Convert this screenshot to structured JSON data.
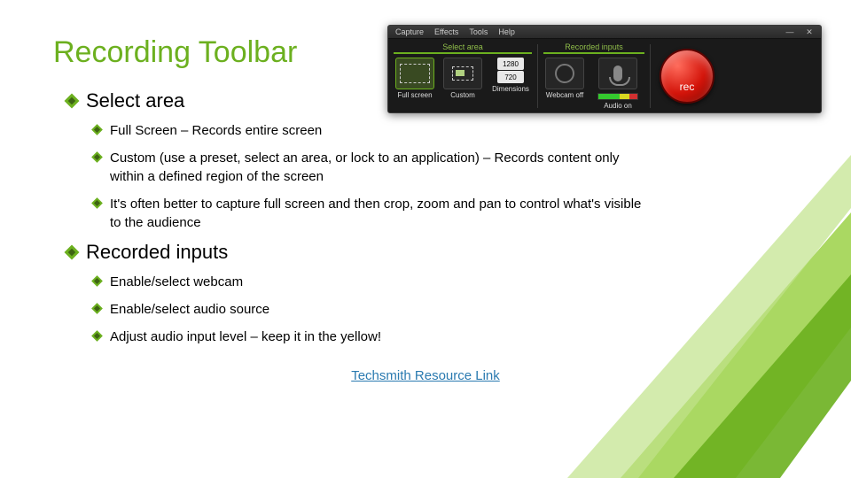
{
  "title": "Recording Toolbar",
  "sections": [
    {
      "heading": "Select area",
      "items": [
        "Full Screen – Records entire screen",
        "Custom (use a preset, select an area, or lock to an application) – Records content only within a defined region of the screen",
        "It's often better to capture full screen and then crop, zoom and pan to control what's visible to the audience"
      ]
    },
    {
      "heading": "Recorded inputs",
      "items": [
        "Enable/select webcam",
        "Enable/select audio source",
        "Adjust audio input level – keep it in the yellow!"
      ]
    }
  ],
  "link_text": "Techsmith Resource Link",
  "toolbar": {
    "menus": [
      "Capture",
      "Effects",
      "Tools",
      "Help"
    ],
    "group1_title": "Select area",
    "group2_title": "Recorded inputs",
    "fullscreen": "Full screen",
    "custom": "Custom",
    "dimensions": "Dimensions",
    "dim_w": "1280",
    "dim_h": "720",
    "webcam": "Webcam off",
    "audio": "Audio on",
    "rec": "rec"
  }
}
